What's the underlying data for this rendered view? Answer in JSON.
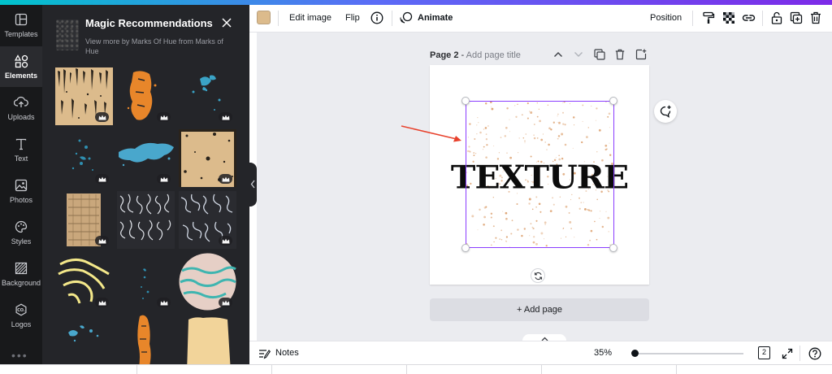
{
  "rail": {
    "items": [
      {
        "label": "Templates",
        "icon": "templates-icon"
      },
      {
        "label": "Elements",
        "icon": "elements-icon",
        "active": true
      },
      {
        "label": "Uploads",
        "icon": "uploads-icon"
      },
      {
        "label": "Text",
        "icon": "text-icon"
      },
      {
        "label": "Photos",
        "icon": "photos-icon"
      },
      {
        "label": "Styles",
        "icon": "styles-icon"
      },
      {
        "label": "Background",
        "icon": "background-icon"
      },
      {
        "label": "Logos",
        "icon": "logos-icon"
      }
    ],
    "more": "•••"
  },
  "panel": {
    "title": "Magic Recommendations",
    "subtitle": "View more by Marks Of Hue from Marks of Hue",
    "close_icon": "close-icon",
    "premium_icon": "crown-icon"
  },
  "toolbar": {
    "swatch_color": "#dcbb8c",
    "edit_image": "Edit image",
    "flip": "Flip",
    "animate": "Animate",
    "position": "Position"
  },
  "workspace": {
    "page_label": "Page 2",
    "page_sep": " - ",
    "page_title_placeholder": "Add page title",
    "canvas_text": "TEXTURE",
    "add_page": "+ Add page"
  },
  "bottombar": {
    "notes": "Notes",
    "zoom": "35%",
    "zoom_fraction": 0.0,
    "page_count": "2"
  },
  "colors": {
    "accent": "#8b3dff",
    "panel_bg": "#242529",
    "rail_bg": "#18191b",
    "workspace_bg": "#ebecf0",
    "speckle": "#dca06e",
    "annotation_arrow": "#e8412c"
  }
}
